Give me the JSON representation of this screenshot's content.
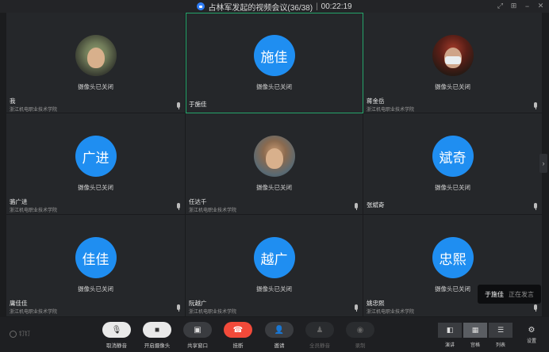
{
  "window": {
    "title": "占林军发起的视频会议(36/38)",
    "separator": "|",
    "timer": "00:22:19"
  },
  "participants": [
    {
      "name": "我",
      "org": "浙江机电职业技术学院",
      "status": "摄像头已关闭",
      "avatar_text": "",
      "avatar_type": "photo1"
    },
    {
      "name": "于施佳",
      "org": "",
      "status": "摄像头已关闭",
      "avatar_text": "施佳",
      "avatar_type": "initials"
    },
    {
      "name": "蒋金岳",
      "org": "浙江机电职业技术学院",
      "status": "摄像头已关闭",
      "avatar_text": "",
      "avatar_type": "photo2"
    },
    {
      "name": "骆广进",
      "org": "浙江机电职业技术学院",
      "status": "摄像头已关闭",
      "avatar_text": "广进",
      "avatar_type": "initials"
    },
    {
      "name": "任达千",
      "org": "浙江机电职业技术学院",
      "status": "摄像头已关闭",
      "avatar_text": "",
      "avatar_type": "photo3"
    },
    {
      "name": "张斌奇",
      "org": "",
      "status": "摄像头已关闭",
      "avatar_text": "斌奇",
      "avatar_type": "initials"
    },
    {
      "name": "庸佳佳",
      "org": "浙江机电职业技术学院",
      "status": "摄像头已关闭",
      "avatar_text": "佳佳",
      "avatar_type": "initials"
    },
    {
      "name": "阮越广",
      "org": "浙江机电职业技术学院",
      "status": "摄像头已关闭",
      "avatar_text": "越广",
      "avatar_type": "initials"
    },
    {
      "name": "姚忠熙",
      "org": "浙江机电职业技术学院",
      "status": "摄像头已关闭",
      "avatar_text": "忠熙",
      "avatar_type": "initials"
    }
  ],
  "speaking": {
    "name": "于施佳",
    "status": "正在发言"
  },
  "toolbar": {
    "logo": "钉钉",
    "unmute": "取消静音",
    "camera_on": "开启摄像头",
    "share": "共享窗口",
    "hangup": "挂断",
    "invite": "邀请",
    "mute_all": "全员静音",
    "record": "录制",
    "view_speaker": "演讲",
    "view_grid": "宫格",
    "view_list": "列表",
    "settings": "设置"
  },
  "colors": {
    "accent_blue": "#1f8ef1",
    "active_border": "#24a56a",
    "hangup_red": "#f24a3a"
  }
}
